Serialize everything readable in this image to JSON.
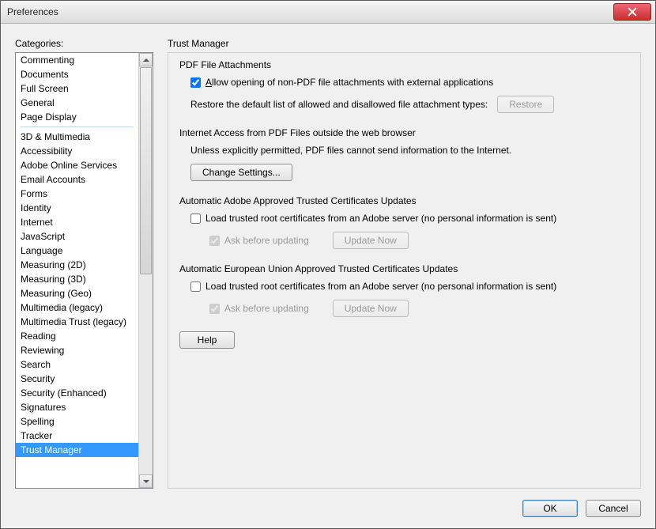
{
  "window": {
    "title": "Preferences"
  },
  "left": {
    "label": "Categories:",
    "group1": [
      "Commenting",
      "Documents",
      "Full Screen",
      "General",
      "Page Display"
    ],
    "items": [
      "3D & Multimedia",
      "Accessibility",
      "Adobe Online Services",
      "Email Accounts",
      "Forms",
      "Identity",
      "Internet",
      "JavaScript",
      "Language",
      "Measuring (2D)",
      "Measuring (3D)",
      "Measuring (Geo)",
      "Multimedia (legacy)",
      "Multimedia Trust (legacy)",
      "Reading",
      "Reviewing",
      "Search",
      "Security",
      "Security (Enhanced)",
      "Signatures",
      "Spelling",
      "Tracker",
      "Trust Manager"
    ],
    "selected": "Trust Manager"
  },
  "right": {
    "title": "Trust Manager",
    "pdfAttachments": {
      "title": "PDF File Attachments",
      "allowLabel": "Allow opening of non-PDF file attachments with external applications",
      "allowChecked": true,
      "restoreLabel": "Restore the default list of allowed and disallowed file attachment types:",
      "restoreBtn": "Restore"
    },
    "internet": {
      "title": "Internet Access from PDF Files outside the web browser",
      "desc": "Unless explicitly permitted, PDF files cannot send information to the Internet.",
      "changeBtn": "Change Settings..."
    },
    "adobeCerts": {
      "title": "Automatic Adobe Approved Trusted Certificates Updates",
      "loadLabel": "Load trusted root certificates from an Adobe server (no personal information is sent)",
      "loadChecked": false,
      "askLabel": "Ask before updating",
      "askChecked": true,
      "updateBtn": "Update Now"
    },
    "euCerts": {
      "title": "Automatic European Union Approved Trusted Certificates Updates",
      "loadLabel": "Load trusted root certificates from an Adobe server (no personal information is sent)",
      "loadChecked": false,
      "askLabel": "Ask before updating",
      "askChecked": true,
      "updateBtn": "Update Now"
    },
    "helpBtn": "Help"
  },
  "footer": {
    "ok": "OK",
    "cancel": "Cancel"
  }
}
